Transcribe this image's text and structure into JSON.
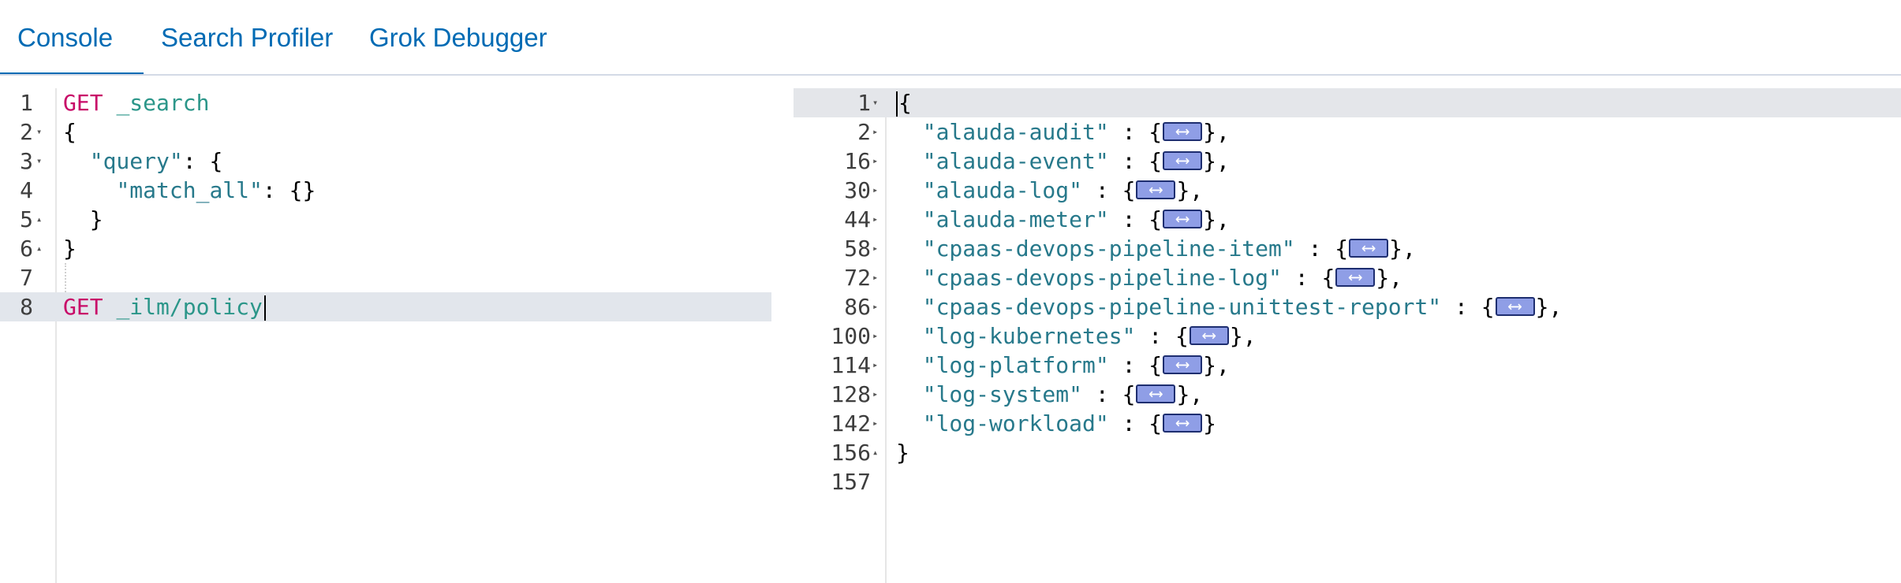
{
  "tabs": [
    {
      "label": "Console",
      "active": true
    },
    {
      "label": "Search Profiler",
      "active": false
    },
    {
      "label": "Grok Debugger",
      "active": false
    }
  ],
  "colors": {
    "accent": "#006bb4",
    "keyword": "#c80a68",
    "path": "#2b9689",
    "string": "#27798b",
    "fold_widget": "#8f9ee6"
  },
  "request_editor": {
    "lines": [
      {
        "num": "1",
        "parts": [
          {
            "t": "GET",
            "c": "kw"
          },
          {
            "t": " ",
            "c": "punct"
          },
          {
            "t": "_search",
            "c": "path"
          }
        ]
      },
      {
        "num": "2",
        "fold": "open",
        "parts": [
          {
            "t": "{",
            "c": "punct"
          }
        ]
      },
      {
        "num": "3",
        "fold": "open",
        "parts": [
          {
            "t": "  ",
            "c": "punct"
          },
          {
            "t": "\"query\"",
            "c": "str"
          },
          {
            "t": ": {",
            "c": "punct"
          }
        ]
      },
      {
        "num": "4",
        "parts": [
          {
            "t": "    ",
            "c": "punct"
          },
          {
            "t": "\"match_all\"",
            "c": "str"
          },
          {
            "t": ": {}",
            "c": "punct"
          }
        ]
      },
      {
        "num": "5",
        "fold": "close",
        "parts": [
          {
            "t": "  }",
            "c": "punct"
          }
        ]
      },
      {
        "num": "6",
        "fold": "close",
        "parts": [
          {
            "t": "}",
            "c": "punct"
          }
        ]
      },
      {
        "num": "7",
        "parts": []
      },
      {
        "num": "8",
        "active": true,
        "parts": [
          {
            "t": "GET",
            "c": "kw"
          },
          {
            "t": " ",
            "c": "punct"
          },
          {
            "t": "_ilm/policy",
            "c": "path"
          }
        ]
      }
    ],
    "actions": {
      "send_icon": "play-icon",
      "settings_icon": "wrench-icon"
    }
  },
  "response_viewer": {
    "lines": [
      {
        "num": "1",
        "fold": "open",
        "active": true,
        "parts": [
          {
            "t": "{",
            "c": "punct"
          }
        ]
      },
      {
        "num": "2",
        "fold": "collapsed",
        "parts": [
          {
            "t": "  ",
            "c": "punct"
          },
          {
            "t": "\"alauda-audit\"",
            "c": "str"
          },
          {
            "t": " : {",
            "c": "punct"
          },
          {
            "t": "",
            "c": "widget"
          },
          {
            "t": "},",
            "c": "punct"
          }
        ]
      },
      {
        "num": "16",
        "fold": "collapsed",
        "parts": [
          {
            "t": "  ",
            "c": "punct"
          },
          {
            "t": "\"alauda-event\"",
            "c": "str"
          },
          {
            "t": " : {",
            "c": "punct"
          },
          {
            "t": "",
            "c": "widget"
          },
          {
            "t": "},",
            "c": "punct"
          }
        ]
      },
      {
        "num": "30",
        "fold": "collapsed",
        "parts": [
          {
            "t": "  ",
            "c": "punct"
          },
          {
            "t": "\"alauda-log\"",
            "c": "str"
          },
          {
            "t": " : {",
            "c": "punct"
          },
          {
            "t": "",
            "c": "widget"
          },
          {
            "t": "},",
            "c": "punct"
          }
        ]
      },
      {
        "num": "44",
        "fold": "collapsed",
        "parts": [
          {
            "t": "  ",
            "c": "punct"
          },
          {
            "t": "\"alauda-meter\"",
            "c": "str"
          },
          {
            "t": " : {",
            "c": "punct"
          },
          {
            "t": "",
            "c": "widget"
          },
          {
            "t": "},",
            "c": "punct"
          }
        ]
      },
      {
        "num": "58",
        "fold": "collapsed",
        "parts": [
          {
            "t": "  ",
            "c": "punct"
          },
          {
            "t": "\"cpaas-devops-pipeline-item\"",
            "c": "str"
          },
          {
            "t": " : {",
            "c": "punct"
          },
          {
            "t": "",
            "c": "widget"
          },
          {
            "t": "},",
            "c": "punct"
          }
        ]
      },
      {
        "num": "72",
        "fold": "collapsed",
        "parts": [
          {
            "t": "  ",
            "c": "punct"
          },
          {
            "t": "\"cpaas-devops-pipeline-log\"",
            "c": "str"
          },
          {
            "t": " : {",
            "c": "punct"
          },
          {
            "t": "",
            "c": "widget"
          },
          {
            "t": "},",
            "c": "punct"
          }
        ]
      },
      {
        "num": "86",
        "fold": "collapsed",
        "parts": [
          {
            "t": "  ",
            "c": "punct"
          },
          {
            "t": "\"cpaas-devops-pipeline-unittest-report\"",
            "c": "str"
          },
          {
            "t": " : {",
            "c": "punct"
          },
          {
            "t": "",
            "c": "widget"
          },
          {
            "t": "},",
            "c": "punct"
          }
        ]
      },
      {
        "num": "100",
        "fold": "collapsed",
        "parts": [
          {
            "t": "  ",
            "c": "punct"
          },
          {
            "t": "\"log-kubernetes\"",
            "c": "str"
          },
          {
            "t": " : {",
            "c": "punct"
          },
          {
            "t": "",
            "c": "widget"
          },
          {
            "t": "},",
            "c": "punct"
          }
        ]
      },
      {
        "num": "114",
        "fold": "collapsed",
        "parts": [
          {
            "t": "  ",
            "c": "punct"
          },
          {
            "t": "\"log-platform\"",
            "c": "str"
          },
          {
            "t": " : {",
            "c": "punct"
          },
          {
            "t": "",
            "c": "widget"
          },
          {
            "t": "},",
            "c": "punct"
          }
        ]
      },
      {
        "num": "128",
        "fold": "collapsed",
        "parts": [
          {
            "t": "  ",
            "c": "punct"
          },
          {
            "t": "\"log-system\"",
            "c": "str"
          },
          {
            "t": " : {",
            "c": "punct"
          },
          {
            "t": "",
            "c": "widget"
          },
          {
            "t": "},",
            "c": "punct"
          }
        ]
      },
      {
        "num": "142",
        "fold": "collapsed",
        "parts": [
          {
            "t": "  ",
            "c": "punct"
          },
          {
            "t": "\"log-workload\"",
            "c": "str"
          },
          {
            "t": " : {",
            "c": "punct"
          },
          {
            "t": "",
            "c": "widget"
          },
          {
            "t": "}",
            "c": "punct"
          }
        ]
      },
      {
        "num": "156",
        "fold": "close",
        "parts": [
          {
            "t": "}",
            "c": "punct"
          }
        ]
      },
      {
        "num": "157",
        "parts": []
      }
    ]
  }
}
